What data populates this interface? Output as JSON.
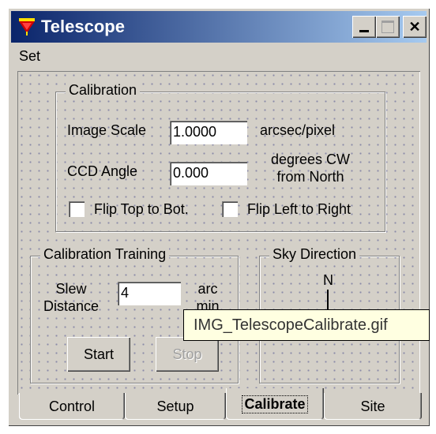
{
  "window": {
    "title": "Telescope",
    "icon": "telescope-app-icon",
    "controls": {
      "minimize": "minimize-icon",
      "maximize": "maximize-icon",
      "close": "close-icon"
    }
  },
  "menu": {
    "set": "Set"
  },
  "calibration": {
    "title": "Calibration",
    "image_scale_label": "Image Scale",
    "image_scale_value": "1.0000",
    "image_scale_unit": "arcsec/pixel",
    "ccd_angle_label": "CCD Angle",
    "ccd_angle_value": "0.000",
    "ccd_angle_unit": "degrees CW from North",
    "flip_top_label": "Flip Top to Bot.",
    "flip_left_label": "Flip Left to Right"
  },
  "training": {
    "title": "Calibration Training",
    "slew_label": "Slew Distance",
    "slew_value": "4",
    "slew_unit": "arc min",
    "start_label": "Start",
    "stop_label": "Stop"
  },
  "sky": {
    "title": "Sky Direction",
    "north_label": "N"
  },
  "tooltip": "IMG_TelescopeCalibrate.gif",
  "tabs": [
    "Control",
    "Setup",
    "Calibrate",
    "Site"
  ],
  "active_tab": "Calibrate"
}
